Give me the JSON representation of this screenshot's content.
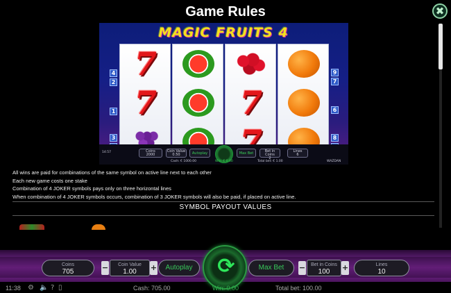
{
  "header": {
    "title": "Game Rules",
    "close_icon": "✖"
  },
  "preview": {
    "logo_text": "MAGIC FRUITS 4",
    "reels": [
      [
        "seven",
        "seven",
        "grapes"
      ],
      [
        "melon",
        "melon",
        "melon"
      ],
      [
        "berries",
        "seven",
        "seven"
      ],
      [
        "orange",
        "orange",
        "orange"
      ]
    ],
    "left_lines": [
      "4",
      "2",
      "1",
      "3",
      "5"
    ],
    "right_lines": [
      "9",
      "7",
      "6",
      "8",
      "10"
    ],
    "mini_bar": {
      "time": "14:57",
      "coins_label": "Coins",
      "coins_value": "2000",
      "coin_value_label": "Coin Value",
      "coin_value": "0.50",
      "autoplay": "Autoplay",
      "max_bet": "Max Bet",
      "bet_in_coins_label": "Bet in Coins",
      "bet_in_coins_value": "2",
      "lines_label": "Lines",
      "lines_value": "6",
      "cash": "Cash: € 1000.00",
      "win": "Win: € 0.00",
      "total_bet": "Total bet: € 1.00",
      "brand": "WAZDAN"
    }
  },
  "rules": [
    "All wins are paid for combinations of the same symbol on active line next to each other",
    "Each new game costs one stake",
    "Combination of 4 JOKER symbols pays only on three horizontal lines",
    "When combination of 4 JOKER symbols occurs, combination of 3 JOKER symbols will also be paid, if placed on active line."
  ],
  "section_title": "SYMBOL PAYOUT VALUES",
  "controls": {
    "coins_label": "Coins",
    "coins_value": "705",
    "coin_value_label": "Coin Value",
    "coin_value": "1.00",
    "autoplay": "Autoplay",
    "max_bet": "Max Bet",
    "bet_in_coins_label": "Bet in Coins",
    "bet_in_coins_value": "100",
    "lines_label": "Lines",
    "lines_value": "10",
    "minus": "−",
    "plus": "+",
    "spin_icon": "⟳"
  },
  "status": {
    "time": "11:38",
    "cash": "Cash: 705.00",
    "win": "Win: 0.00",
    "total_bet": "Total bet: 100.00",
    "icons": [
      "gear-icon",
      "speaker-icon",
      "help-icon",
      "paytable-icon"
    ]
  },
  "colors": {
    "accent_green": "#2fb24e",
    "bar_purple": "#8c2ea8",
    "seven_red": "#e3161a"
  }
}
